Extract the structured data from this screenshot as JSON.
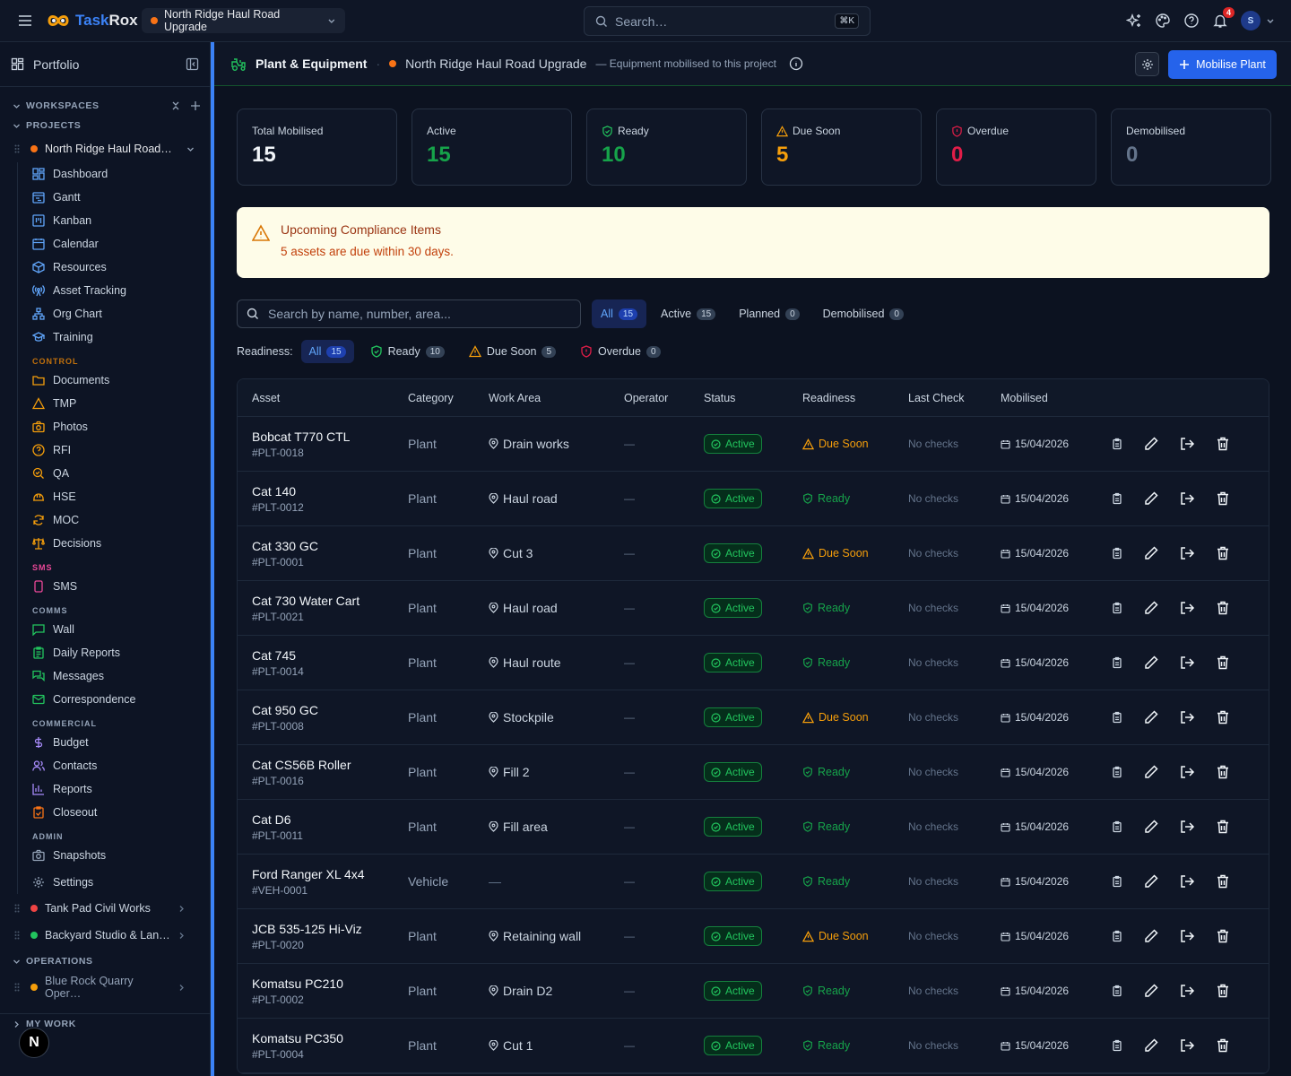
{
  "app": {
    "name_prefix": "Task",
    "name_suffix": "Rox"
  },
  "topbar": {
    "project": "North Ridge Haul Road Upgrade",
    "search_placeholder": "Search…",
    "search_kbd": "⌘K",
    "notifications": "4",
    "avatar": "S"
  },
  "sidebar": {
    "portfolio": "Portfolio",
    "workspaces": "WORKSPACES",
    "projects": "PROJECTS",
    "current_project": "North Ridge Haul Road…",
    "nav": [
      "Dashboard",
      "Gantt",
      "Kanban",
      "Calendar",
      "Resources",
      "Asset Tracking",
      "Org Chart",
      "Training"
    ],
    "control_label": "CONTROL",
    "control": [
      "Documents",
      "TMP",
      "Photos",
      "RFI",
      "QA",
      "HSE",
      "MOC",
      "Decisions"
    ],
    "sms_label": "SMS",
    "sms": [
      "SMS"
    ],
    "comms_label": "COMMS",
    "comms": [
      "Wall",
      "Daily Reports",
      "Messages",
      "Correspondence"
    ],
    "commercial_label": "COMMERCIAL",
    "commercial": [
      "Budget",
      "Contacts",
      "Reports",
      "Closeout"
    ],
    "admin_label": "ADMIN",
    "admin": [
      "Snapshots"
    ],
    "settings": "Settings",
    "other_projects": [
      {
        "name": "Tank Pad Civil Works",
        "color": "#ef4444"
      },
      {
        "name": "Backyard Studio & Lan…",
        "color": "#22c55e"
      }
    ],
    "operations": "OPERATIONS",
    "operations_project": "Blue Rock Quarry Oper…",
    "my_work": "MY WORK"
  },
  "page": {
    "title": "Plant & Equipment",
    "project": "North Ridge Haul Road Upgrade",
    "description": "— Equipment mobilised to this project",
    "primary_button": "Mobilise Plant"
  },
  "stats": [
    {
      "label": "Total Mobilised",
      "value": "15",
      "color": "#f1f5f9"
    },
    {
      "label": "Active",
      "value": "15",
      "color": "#16a34a"
    },
    {
      "label": "Ready",
      "value": "10",
      "color": "#16a34a"
    },
    {
      "label": "Due Soon",
      "value": "5",
      "color": "#f59e0b"
    },
    {
      "label": "Overdue",
      "value": "0",
      "color": "#e11d48"
    },
    {
      "label": "Demobilised",
      "value": "0",
      "color": "#64748b"
    }
  ],
  "alert": {
    "title": "Upcoming Compliance Items",
    "detail": "5 assets are due within 30 days."
  },
  "filters": {
    "search_placeholder": "Search by name, number, area...",
    "tabs": [
      {
        "label": "All",
        "count": "15"
      },
      {
        "label": "Active",
        "count": "15"
      },
      {
        "label": "Planned",
        "count": "0"
      },
      {
        "label": "Demobilised",
        "count": "0"
      }
    ],
    "readiness_label": "Readiness:",
    "readiness": [
      {
        "label": "All",
        "count": "15"
      },
      {
        "label": "Ready",
        "count": "10"
      },
      {
        "label": "Due Soon",
        "count": "5"
      },
      {
        "label": "Overdue",
        "count": "0"
      }
    ]
  },
  "table": {
    "headers": [
      "Asset",
      "Category",
      "Work Area",
      "Operator",
      "Status",
      "Readiness",
      "Last Check",
      "Mobilised"
    ],
    "rows": [
      {
        "name": "Bobcat T770 CTL",
        "id": "#PLT-0018",
        "category": "Plant",
        "area": "Drain works",
        "operator": "—",
        "status": "Active",
        "readiness": "Due Soon",
        "last_check": "No checks",
        "mobilised": "15/04/2026"
      },
      {
        "name": "Cat 140",
        "id": "#PLT-0012",
        "category": "Plant",
        "area": "Haul road",
        "operator": "—",
        "status": "Active",
        "readiness": "Ready",
        "last_check": "No checks",
        "mobilised": "15/04/2026"
      },
      {
        "name": "Cat 330 GC",
        "id": "#PLT-0001",
        "category": "Plant",
        "area": "Cut 3",
        "operator": "—",
        "status": "Active",
        "readiness": "Due Soon",
        "last_check": "No checks",
        "mobilised": "15/04/2026"
      },
      {
        "name": "Cat 730 Water Cart",
        "id": "#PLT-0021",
        "category": "Plant",
        "area": "Haul road",
        "operator": "—",
        "status": "Active",
        "readiness": "Ready",
        "last_check": "No checks",
        "mobilised": "15/04/2026"
      },
      {
        "name": "Cat 745",
        "id": "#PLT-0014",
        "category": "Plant",
        "area": "Haul route",
        "operator": "—",
        "status": "Active",
        "readiness": "Ready",
        "last_check": "No checks",
        "mobilised": "15/04/2026"
      },
      {
        "name": "Cat 950 GC",
        "id": "#PLT-0008",
        "category": "Plant",
        "area": "Stockpile",
        "operator": "—",
        "status": "Active",
        "readiness": "Due Soon",
        "last_check": "No checks",
        "mobilised": "15/04/2026"
      },
      {
        "name": "Cat CS56B Roller",
        "id": "#PLT-0016",
        "category": "Plant",
        "area": "Fill 2",
        "operator": "—",
        "status": "Active",
        "readiness": "Ready",
        "last_check": "No checks",
        "mobilised": "15/04/2026"
      },
      {
        "name": "Cat D6",
        "id": "#PLT-0011",
        "category": "Plant",
        "area": "Fill area",
        "operator": "—",
        "status": "Active",
        "readiness": "Ready",
        "last_check": "No checks",
        "mobilised": "15/04/2026"
      },
      {
        "name": "Ford Ranger XL 4x4",
        "id": "#VEH-0001",
        "category": "Vehicle",
        "area": "—",
        "operator": "—",
        "status": "Active",
        "readiness": "Ready",
        "last_check": "No checks",
        "mobilised": "15/04/2026"
      },
      {
        "name": "JCB 535-125 Hi-Viz",
        "id": "#PLT-0020",
        "category": "Plant",
        "area": "Retaining wall",
        "operator": "—",
        "status": "Active",
        "readiness": "Due Soon",
        "last_check": "No checks",
        "mobilised": "15/04/2026"
      },
      {
        "name": "Komatsu PC210",
        "id": "#PLT-0002",
        "category": "Plant",
        "area": "Drain D2",
        "operator": "—",
        "status": "Active",
        "readiness": "Ready",
        "last_check": "No checks",
        "mobilised": "15/04/2026"
      },
      {
        "name": "Komatsu PC350",
        "id": "#PLT-0004",
        "category": "Plant",
        "area": "Cut 1",
        "operator": "—",
        "status": "Active",
        "readiness": "Ready",
        "last_check": "No checks",
        "mobilised": "15/04/2026"
      }
    ]
  },
  "fab": "N"
}
